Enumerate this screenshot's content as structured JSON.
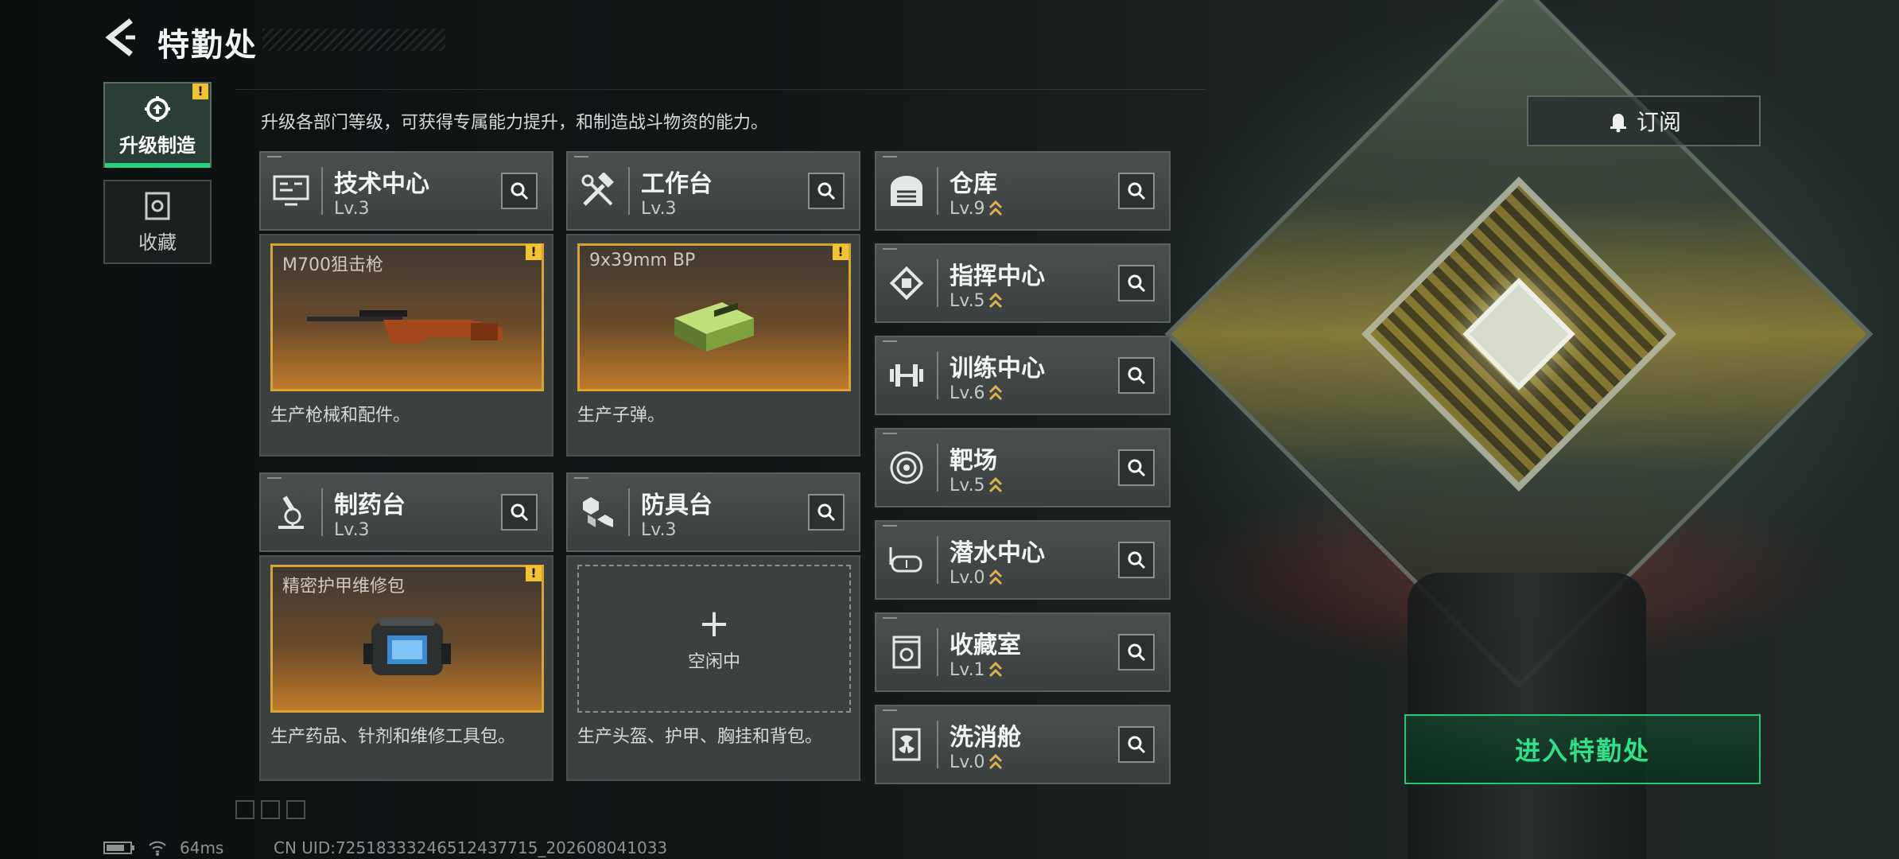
{
  "header": {
    "title": "特勤处"
  },
  "side_tabs": [
    {
      "label": "升级制造",
      "active": true,
      "warn": "!"
    },
    {
      "label": "收藏",
      "active": false
    }
  ],
  "description": "升级各部门等级，可获得专属能力提升，和制造战斗物资的能力。",
  "subscribe": {
    "label": "订阅"
  },
  "departments_main": [
    {
      "name": "技术中心",
      "level": "Lv.3",
      "icon": "monitor-icon"
    },
    {
      "name": "工作台",
      "level": "Lv.3",
      "icon": "hammer-wrench-icon"
    },
    {
      "name": "制药台",
      "level": "Lv.3",
      "icon": "microscope-icon"
    },
    {
      "name": "防具台",
      "level": "Lv.3",
      "icon": "blocks-icon"
    }
  ],
  "production": [
    {
      "item": "M700狙击枪",
      "desc": "生产枪械和配件。",
      "warn": "!"
    },
    {
      "item": "9x39mm BP",
      "desc": "生产子弹。",
      "warn": "!"
    },
    {
      "item": "精密护甲维修包",
      "desc": "生产药品、针剂和维修工具包。",
      "warn": "!"
    },
    {
      "item": "",
      "empty_label": "空闲中",
      "plus": "+",
      "desc": "生产头盔、护甲、胸挂和背包。"
    }
  ],
  "departments_side": [
    {
      "name": "仓库",
      "level": "Lv.9",
      "icon": "warehouse-icon"
    },
    {
      "name": "指挥中心",
      "level": "Lv.5",
      "icon": "chip-icon"
    },
    {
      "name": "训练中心",
      "level": "Lv.6",
      "icon": "dumbbell-icon"
    },
    {
      "name": "靶场",
      "level": "Lv.5",
      "icon": "target-icon"
    },
    {
      "name": "潜水中心",
      "level": "Lv.0",
      "icon": "diving-mask-icon"
    },
    {
      "name": "收藏室",
      "level": "Lv.1",
      "icon": "trophy-case-icon"
    },
    {
      "name": "洗消舱",
      "level": "Lv.0",
      "icon": "radiation-icon"
    }
  ],
  "enter_button": {
    "label": "进入特勤处"
  },
  "status": {
    "ping": "64ms",
    "uid": "CN UID:7251833324651243771​5_202608041033"
  },
  "colors": {
    "accent": "#24c774",
    "warn": "#f2c230",
    "slot_border": "#d9a532"
  }
}
